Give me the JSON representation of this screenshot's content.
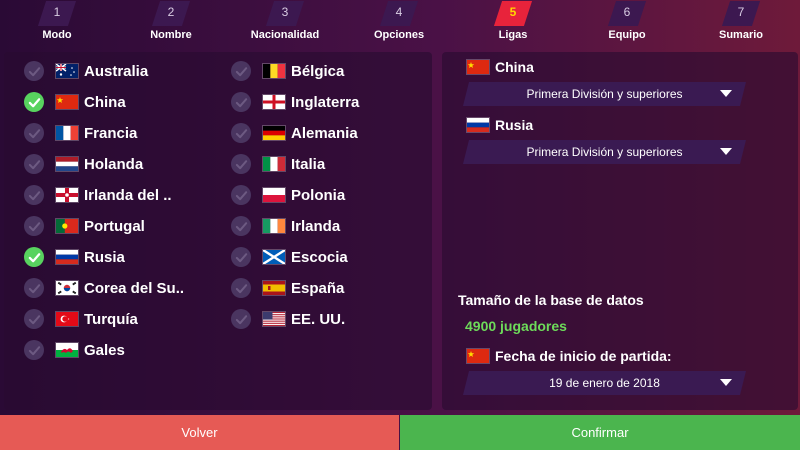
{
  "steps": [
    {
      "num": "1",
      "label": "Modo"
    },
    {
      "num": "2",
      "label": "Nombre"
    },
    {
      "num": "3",
      "label": "Nacionalidad"
    },
    {
      "num": "4",
      "label": "Opciones"
    },
    {
      "num": "5",
      "label": "Ligas",
      "active": true
    },
    {
      "num": "6",
      "label": "Equipo"
    },
    {
      "num": "7",
      "label": "Sumario"
    }
  ],
  "countries_col1": [
    {
      "name": "Australia",
      "checked": false,
      "icon": "flag-australia"
    },
    {
      "name": "China",
      "checked": true,
      "icon": "flag-china"
    },
    {
      "name": "Francia",
      "checked": false,
      "icon": "flag-france"
    },
    {
      "name": "Holanda",
      "checked": false,
      "icon": "flag-netherlands"
    },
    {
      "name": "Irlanda del ..",
      "checked": false,
      "icon": "flag-northern-ireland"
    },
    {
      "name": "Portugal",
      "checked": false,
      "icon": "flag-portugal"
    },
    {
      "name": "Rusia",
      "checked": true,
      "icon": "flag-russia"
    },
    {
      "name": "Corea del Su..",
      "checked": false,
      "icon": "flag-south-korea"
    },
    {
      "name": "Turquía",
      "checked": false,
      "icon": "flag-turkey"
    },
    {
      "name": "Gales",
      "checked": false,
      "icon": "flag-wales"
    }
  ],
  "countries_col2": [
    {
      "name": "Bélgica",
      "checked": false,
      "icon": "flag-belgium"
    },
    {
      "name": "Inglaterra",
      "checked": false,
      "icon": "flag-england"
    },
    {
      "name": "Alemania",
      "checked": false,
      "icon": "flag-germany"
    },
    {
      "name": "Italia",
      "checked": false,
      "icon": "flag-italy"
    },
    {
      "name": "Polonia",
      "checked": false,
      "icon": "flag-poland"
    },
    {
      "name": "Irlanda",
      "checked": false,
      "icon": "flag-ireland"
    },
    {
      "name": "Escocia",
      "checked": false,
      "icon": "flag-scotland"
    },
    {
      "name": "España",
      "checked": false,
      "icon": "flag-spain"
    },
    {
      "name": "EE. UU.",
      "checked": false,
      "icon": "flag-usa"
    }
  ],
  "selected_leagues": [
    {
      "country": "China",
      "level": "Primera División y superiores",
      "icon": "flag-china"
    },
    {
      "country": "Rusia",
      "level": "Primera División y superiores",
      "icon": "flag-russia"
    }
  ],
  "database": {
    "title": "Tamaño de la base de datos",
    "value": "4900 jugadores"
  },
  "start_date": {
    "label": "Fecha de inicio de partida:",
    "value": "19 de enero de 2018",
    "icon": "flag-china"
  },
  "footer": {
    "back": "Volver",
    "confirm": "Confirmar"
  },
  "colors": {
    "active_step": "#e8233b",
    "check_on": "#58d35f",
    "back_button": "#e65a55",
    "confirm_button": "#4bb54e",
    "db_value": "#6ddb5a"
  }
}
